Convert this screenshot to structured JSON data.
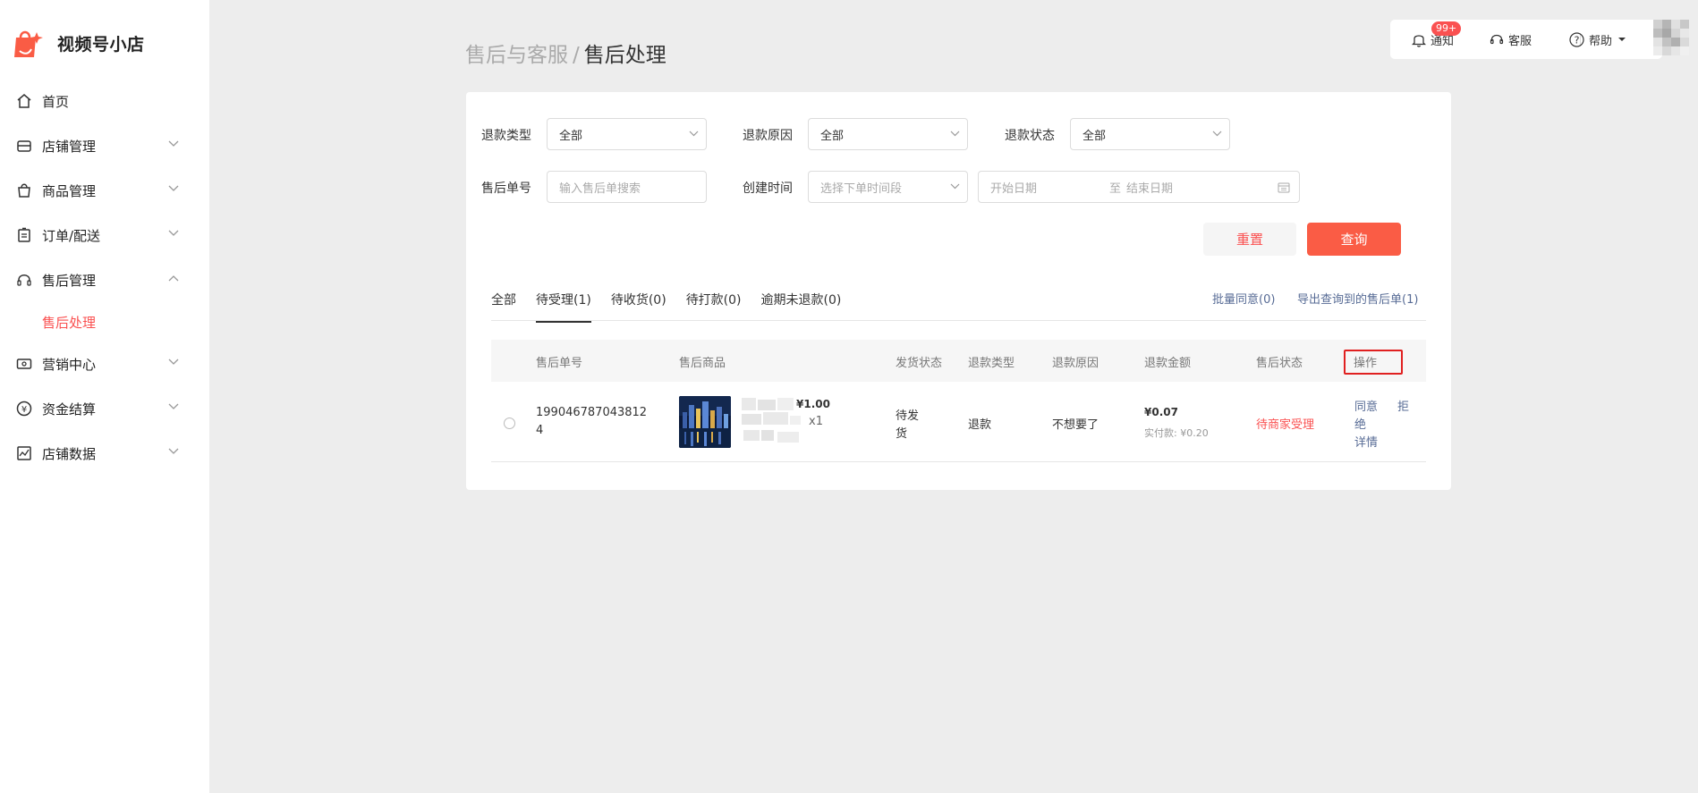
{
  "brand": {
    "name": "视频号小店",
    "accent": "#fa5151"
  },
  "sidebar": {
    "items": [
      {
        "label": "首页",
        "icon": "home-icon"
      },
      {
        "label": "店铺管理",
        "icon": "shop-icon"
      },
      {
        "label": "商品管理",
        "icon": "bag-icon"
      },
      {
        "label": "订单/配送",
        "icon": "clipboard-icon"
      },
      {
        "label": "售后管理",
        "icon": "headset-icon"
      },
      {
        "label": "营销中心",
        "icon": "ticket-icon"
      },
      {
        "label": "资金结算",
        "icon": "yen-icon"
      },
      {
        "label": "店铺数据",
        "icon": "chart-icon"
      }
    ],
    "sub_active": "售后处理"
  },
  "breadcrumb": {
    "parent": "售后与客服",
    "sep": "/",
    "current": "售后处理"
  },
  "topbar": {
    "notice": "通知",
    "badge": "99+",
    "service": "客服",
    "help": "帮助"
  },
  "filters": {
    "refund_type": {
      "label": "退款类型",
      "value": "全部"
    },
    "refund_reason": {
      "label": "退款原因",
      "value": "全部"
    },
    "refund_status": {
      "label": "退款状态",
      "value": "全部"
    },
    "aftersale_no": {
      "label": "售后单号",
      "placeholder": "输入售后单搜索"
    },
    "create_time": {
      "label": "创建时间",
      "placeholder": "选择下单时间段"
    },
    "date_range": {
      "start": "开始日期",
      "to": "至",
      "end": "结束日期"
    }
  },
  "buttons": {
    "reset": "重置",
    "search": "查询"
  },
  "tabs": [
    "全部",
    "待受理(1)",
    "待收货(0)",
    "待打款(0)",
    "逾期未退款(0)"
  ],
  "links": {
    "batch_agree": "批量同意(0)",
    "export": "导出查询到的售后单(1)"
  },
  "table": {
    "headers": [
      "售后单号",
      "售后商品",
      "发货状态",
      "退款类型",
      "退款原因",
      "退款金额",
      "售后状态",
      "操作"
    ],
    "rows": [
      {
        "order_no_line1": "199046787043812",
        "order_no_line2": "4",
        "price": "¥1.00",
        "qty": "x1",
        "ship_line1": "待发",
        "ship_line2": "货",
        "refund_type": "退款",
        "refund_reason": "不想要了",
        "refund_amount": "¥0.07",
        "paid": "实付款: ¥0.20",
        "status": "待商家受理",
        "op_agree": "同意",
        "op_reject_1": "拒",
        "op_reject_2": "绝",
        "op_detail": "详情"
      }
    ]
  }
}
